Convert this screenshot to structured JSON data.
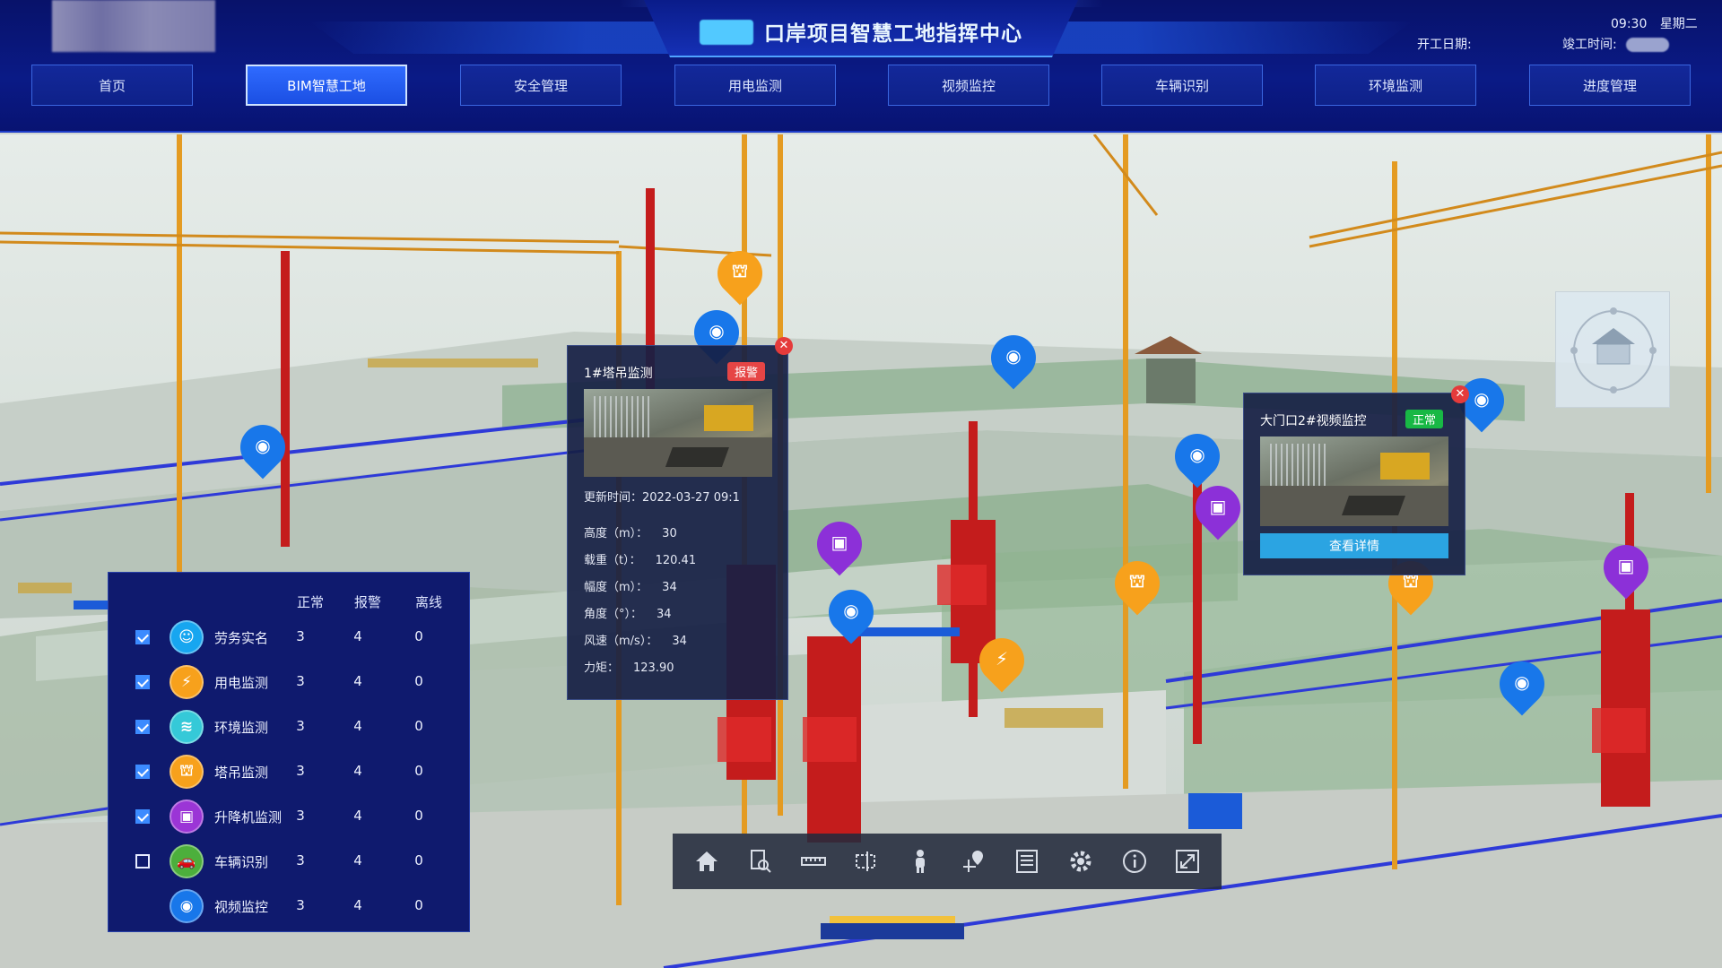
{
  "header": {
    "title": "口岸项目智慧工地指挥中心",
    "time": "09:30",
    "weekday": "星期二",
    "start_date_label": "开工日期:",
    "end_date_label": "竣工时间:"
  },
  "nav": [
    {
      "label": "首页"
    },
    {
      "label": "BIM智慧工地",
      "active": true
    },
    {
      "label": "安全管理"
    },
    {
      "label": "用电监测"
    },
    {
      "label": "视频监控"
    },
    {
      "label": "车辆识别"
    },
    {
      "label": "环境监测"
    },
    {
      "label": "进度管理"
    }
  ],
  "popup_crane": {
    "title": "1#塔吊监测",
    "status": "报警",
    "update_label": "更新时间：",
    "update_time": "2022-03-27 09:1",
    "fields": [
      {
        "label": "高度（m）：",
        "value": "30"
      },
      {
        "label": "载重（t）：",
        "value": "120.41"
      },
      {
        "label": "幅度（m）：",
        "value": "34"
      },
      {
        "label": "角度（°）：",
        "value": "34"
      },
      {
        "label": "风速（m/s）：",
        "value": "34"
      },
      {
        "label": "力矩：",
        "value": "123.90"
      }
    ]
  },
  "popup_camera": {
    "title": "大门口2#视频监控",
    "status": "正常",
    "button": "查看详情"
  },
  "legend": {
    "headers": [
      "正常",
      "报警",
      "离线"
    ],
    "rows": [
      {
        "name": "劳务实名",
        "icon": "worker-icon",
        "color": "#17a6f0",
        "checkbox": "checked",
        "normal": "3",
        "alarm": "4",
        "offline": "0"
      },
      {
        "name": "用电监测",
        "icon": "power-icon",
        "color": "#f7a11c",
        "checkbox": "checked",
        "normal": "3",
        "alarm": "4",
        "offline": "0"
      },
      {
        "name": "环境监测",
        "icon": "environment-icon",
        "color": "#35c9d8",
        "checkbox": "checked",
        "normal": "3",
        "alarm": "4",
        "offline": "0"
      },
      {
        "name": "塔吊监测",
        "icon": "crane-icon",
        "color": "#f7a11c",
        "checkbox": "checked",
        "normal": "3",
        "alarm": "4",
        "offline": "0"
      },
      {
        "name": "升降机监测",
        "icon": "elevator-icon",
        "color": "#9b35d6",
        "checkbox": "checked",
        "normal": "3",
        "alarm": "4",
        "offline": "0"
      },
      {
        "name": "车辆识别",
        "icon": "vehicle-icon",
        "color": "#4caf3c",
        "checkbox": "unchecked",
        "normal": "3",
        "alarm": "4",
        "offline": "0"
      },
      {
        "name": "视频监控",
        "icon": "camera-icon",
        "color": "#1877ea",
        "checkbox": "none",
        "normal": "3",
        "alarm": "4",
        "offline": "0"
      }
    ]
  },
  "toolbar": [
    "home-icon",
    "inspect-icon",
    "measure-icon",
    "section-icon",
    "person-icon",
    "location-icon",
    "list-icon",
    "settings-icon",
    "info-icon",
    "fullscreen-icon"
  ],
  "colors": {
    "header_bg": "#0a1a86",
    "nav_active": "#2f6bff",
    "marker_blue": "#1877ea",
    "marker_orange": "#f7a11c",
    "marker_purple": "#8c30d8",
    "alarm": "#e64545",
    "normal": "#18b845"
  }
}
